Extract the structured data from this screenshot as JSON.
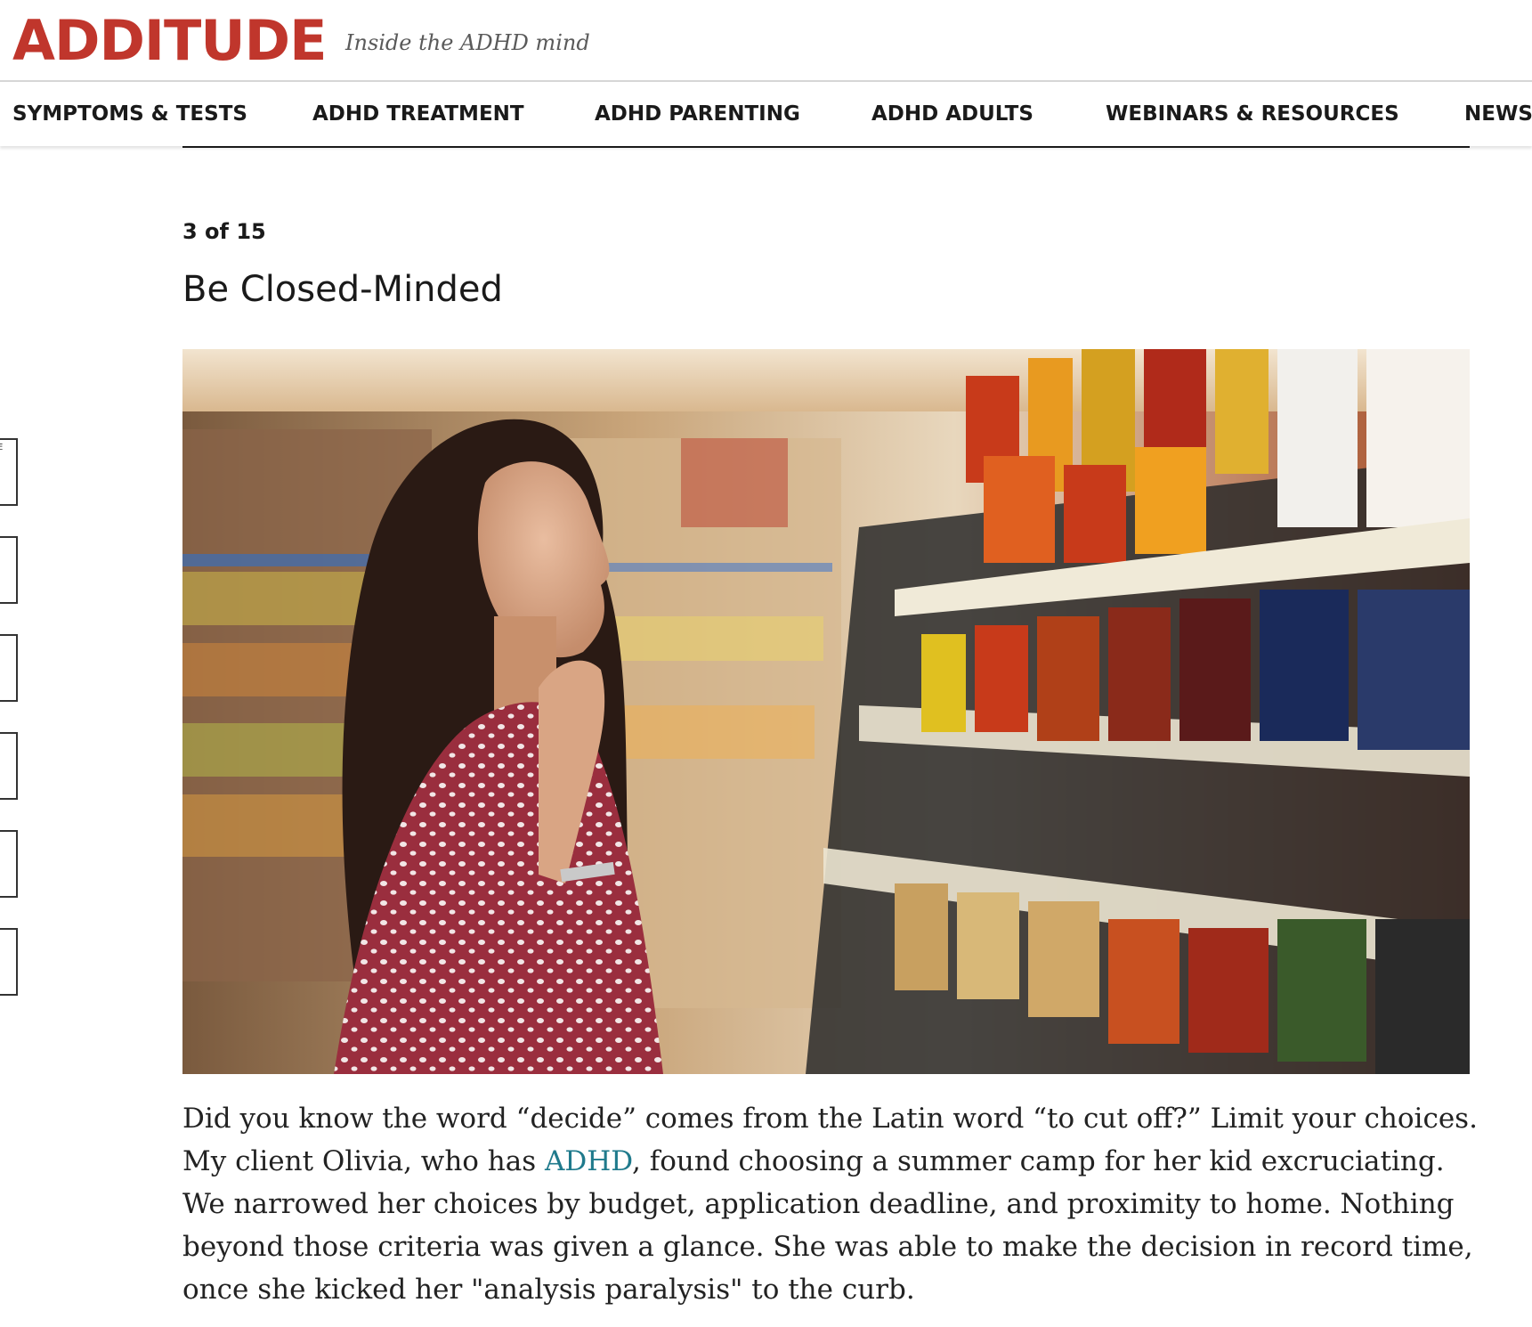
{
  "header": {
    "logo": "ADDITUDE",
    "tagline": "Inside the ADHD mind",
    "brand_color": "#c0362c"
  },
  "nav": {
    "items": [
      {
        "label": "SYMPTOMS & TESTS"
      },
      {
        "label": "ADHD TREATMENT"
      },
      {
        "label": "ADHD PARENTING"
      },
      {
        "label": "ADHD ADULTS"
      },
      {
        "label": "WEBINARS & RESOURCES"
      },
      {
        "label": "NEWSL"
      }
    ]
  },
  "share_rail": {
    "top_glyph": "E",
    "count": 6
  },
  "slide": {
    "counter": "3 of 15",
    "title": "Be Closed-Minded",
    "image_subject": "woman-in-grocery-aisle-photo",
    "body": {
      "part1": "Did you know the word “decide” comes from the Latin word “to cut off?” Limit your choices. My client Olivia, who has ",
      "link_text": "ADHD",
      "part2": ", found choosing a summer camp for her kid excruciating. We narrowed her choices by budget, application deadline, and proximity to home. Nothing beyond those criteria was given a glance. She was able to make the decision in record time, once she kicked her \"analysis paralysis\" to the curb."
    },
    "link_color": "#1f7a8c"
  }
}
